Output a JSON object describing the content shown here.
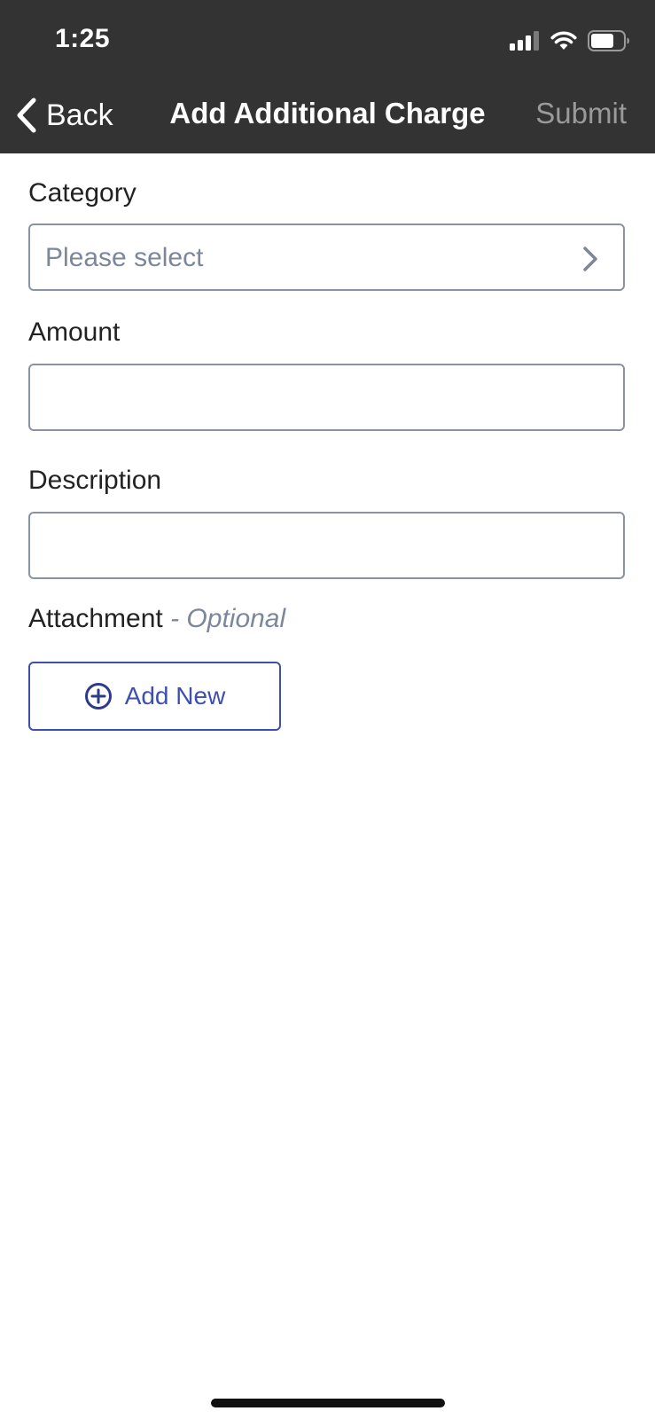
{
  "status_bar": {
    "time": "1:25",
    "icons": [
      "cellular-signal-icon",
      "wifi-icon",
      "battery-icon"
    ]
  },
  "nav_bar": {
    "back_label": "Back",
    "title": "Add Additional Charge",
    "submit_label": "Submit"
  },
  "form": {
    "category": {
      "label": "Category",
      "placeholder": "Please select"
    },
    "amount": {
      "label": "Amount",
      "value": ""
    },
    "description": {
      "label": "Description",
      "value": ""
    },
    "attachment": {
      "label": "Attachment",
      "optional_text": "- Optional",
      "add_new_label": "Add New"
    }
  },
  "colors": {
    "nav_background": "#333333",
    "accent": "#3f4fb0",
    "field_border": "#8a93a5",
    "placeholder": "#7c879b",
    "submit_disabled": "#9a9a9a"
  }
}
